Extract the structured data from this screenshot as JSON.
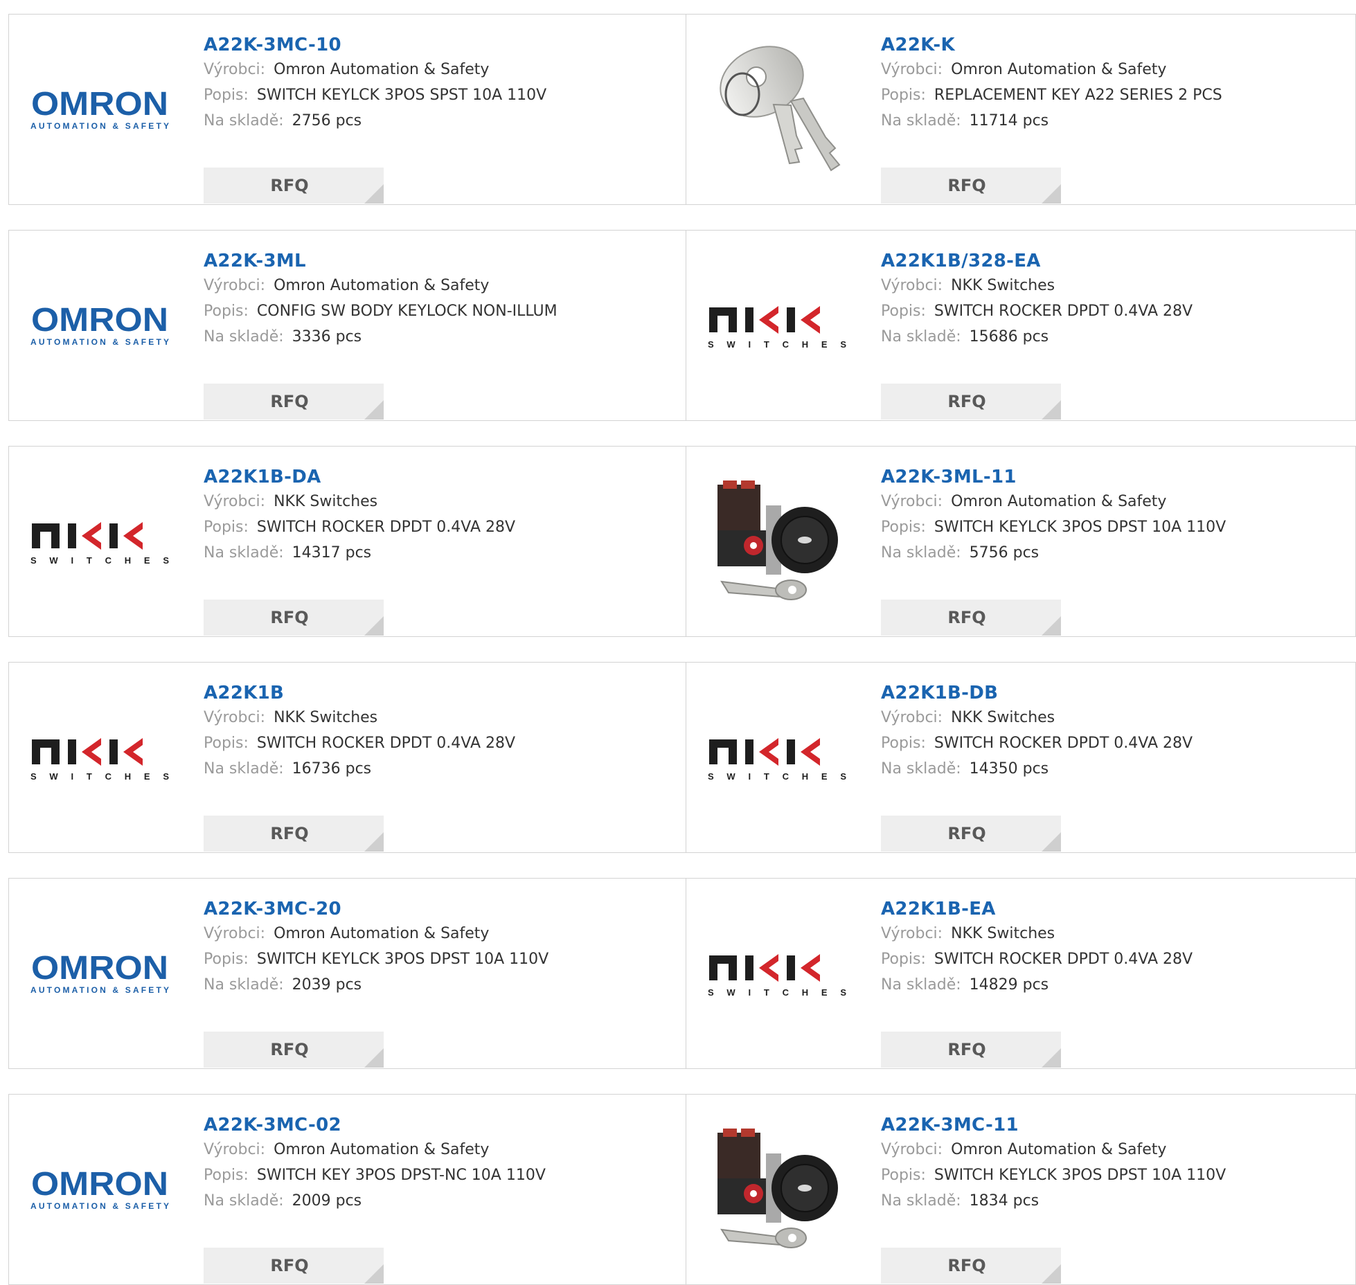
{
  "labels": {
    "manufacturer": "Výrobci:",
    "description": "Popis:",
    "stock": "Na skladě:",
    "rfq": "RFQ"
  },
  "brand_logos": {
    "omron": {
      "line1": "OMRON",
      "line2": "AUTOMATION & SAFETY",
      "color": "#1c5fa8"
    },
    "nkk": {
      "line1": "NKK",
      "line2": "SWITCHES",
      "color": "#1e1e1e",
      "accent": "#d3262b"
    }
  },
  "colors": {
    "part_number": "#1a64b0",
    "label": "#9a9a9a",
    "value": "#333333",
    "button_bg": "#eeeeee"
  },
  "products": [
    {
      "part": "A22K-3MC-10",
      "manufacturer": "Omron Automation & Safety",
      "description": "SWITCH KEYLCK 3POS SPST 10A 110V",
      "stock": "2756 pcs",
      "image": "omron-logo"
    },
    {
      "part": "A22K-K",
      "manufacturer": "Omron Automation & Safety",
      "description": "REPLACEMENT KEY A22 SERIES 2 PCS",
      "stock": "11714 pcs",
      "image": "key-photo"
    },
    {
      "part": "A22K-3ML",
      "manufacturer": "Omron Automation & Safety",
      "description": "CONFIG SW BODY KEYLOCK NON-ILLUM",
      "stock": "3336 pcs",
      "image": "omron-logo"
    },
    {
      "part": "A22K1B/328-EA",
      "manufacturer": "NKK Switches",
      "description": "SWITCH ROCKER DPDT 0.4VA 28V",
      "stock": "15686 pcs",
      "image": "nkk-logo"
    },
    {
      "part": "A22K1B-DA",
      "manufacturer": "NKK Switches",
      "description": "SWITCH ROCKER DPDT 0.4VA 28V",
      "stock": "14317 pcs",
      "image": "nkk-logo"
    },
    {
      "part": "A22K-3ML-11",
      "manufacturer": "Omron Automation & Safety",
      "description": "SWITCH KEYLCK 3POS DPST 10A 110V",
      "stock": "5756 pcs",
      "image": "keyswitch-photo"
    },
    {
      "part": "A22K1B",
      "manufacturer": "NKK Switches",
      "description": "SWITCH ROCKER DPDT 0.4VA 28V",
      "stock": "16736 pcs",
      "image": "nkk-logo"
    },
    {
      "part": "A22K1B-DB",
      "manufacturer": "NKK Switches",
      "description": "SWITCH ROCKER DPDT 0.4VA 28V",
      "stock": "14350 pcs",
      "image": "nkk-logo"
    },
    {
      "part": "A22K-3MC-20",
      "manufacturer": "Omron Automation & Safety",
      "description": "SWITCH KEYLCK 3POS DPST 10A 110V",
      "stock": "2039 pcs",
      "image": "omron-logo"
    },
    {
      "part": "A22K1B-EA",
      "manufacturer": "NKK Switches",
      "description": "SWITCH ROCKER DPDT 0.4VA 28V",
      "stock": "14829 pcs",
      "image": "nkk-logo"
    },
    {
      "part": "A22K-3MC-02",
      "manufacturer": "Omron Automation & Safety",
      "description": "SWITCH KEY 3POS DPST-NC 10A 110V",
      "stock": "2009 pcs",
      "image": "omron-logo"
    },
    {
      "part": "A22K-3MC-11",
      "manufacturer": "Omron Automation & Safety",
      "description": "SWITCH KEYLCK 3POS DPST 10A 110V",
      "stock": "1834 pcs",
      "image": "keyswitch-photo"
    }
  ]
}
